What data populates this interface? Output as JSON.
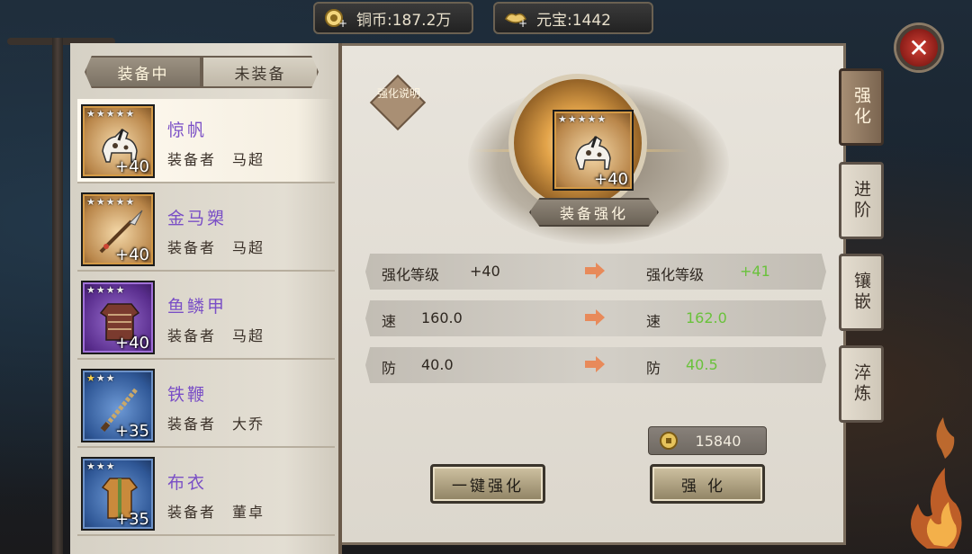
{
  "currency": {
    "coins": "铜币:187.2万",
    "gold": "元宝:1442"
  },
  "tabs": {
    "equipped": "装备中",
    "unequipped": "未装备"
  },
  "items": [
    {
      "name": "惊帆",
      "stars": "★★★★★",
      "gold_stars": "",
      "plus": "+40",
      "owner_label": "装备者",
      "owner": "马超",
      "frame": "orange",
      "icon": "horse-icon"
    },
    {
      "name": "金马槊",
      "stars": "★★★★★",
      "gold_stars": "",
      "plus": "+40",
      "owner_label": "装备者",
      "owner": "马超",
      "frame": "orange",
      "icon": "spear-icon"
    },
    {
      "name": "鱼鳞甲",
      "stars": "★★★★",
      "gold_stars": "",
      "plus": "+40",
      "owner_label": "装备者",
      "owner": "马超",
      "frame": "purple",
      "icon": "armor-icon"
    },
    {
      "name": "铁鞭",
      "stars": "★★",
      "gold_stars": "★",
      "plus": "+35",
      "owner_label": "装备者",
      "owner": "大乔",
      "frame": "blue",
      "icon": "whip-icon"
    },
    {
      "name": "布衣",
      "stars": "★★★",
      "gold_stars": "",
      "plus": "+35",
      "owner_label": "装备者",
      "owner": "董卓",
      "frame": "blue",
      "icon": "cloth-armor-icon"
    }
  ],
  "main": {
    "help": "强化说明",
    "center_item": {
      "stars": "★★★★★",
      "plus": "+40",
      "icon": "horse-icon"
    },
    "enhance_label": "装备强化",
    "stats": [
      {
        "label_before": "强化等级",
        "before": "+40",
        "label_after": "强化等级",
        "after": "+41"
      },
      {
        "label_before": "速",
        "before": "160.0",
        "label_after": "速",
        "after": "162.0"
      },
      {
        "label_before": "防",
        "before": "40.0",
        "label_after": "防",
        "after": "40.5"
      }
    ],
    "cost": "15840",
    "auto_button": "一键强化",
    "strengthen_button": "强化"
  },
  "side_tabs": [
    "强化",
    "进阶",
    "镶嵌",
    "淬炼"
  ],
  "close": "✕",
  "colors": {
    "name_purple": "#7a4fc6",
    "increase_green": "#69c23b",
    "accent_brown": "#7b6550"
  }
}
